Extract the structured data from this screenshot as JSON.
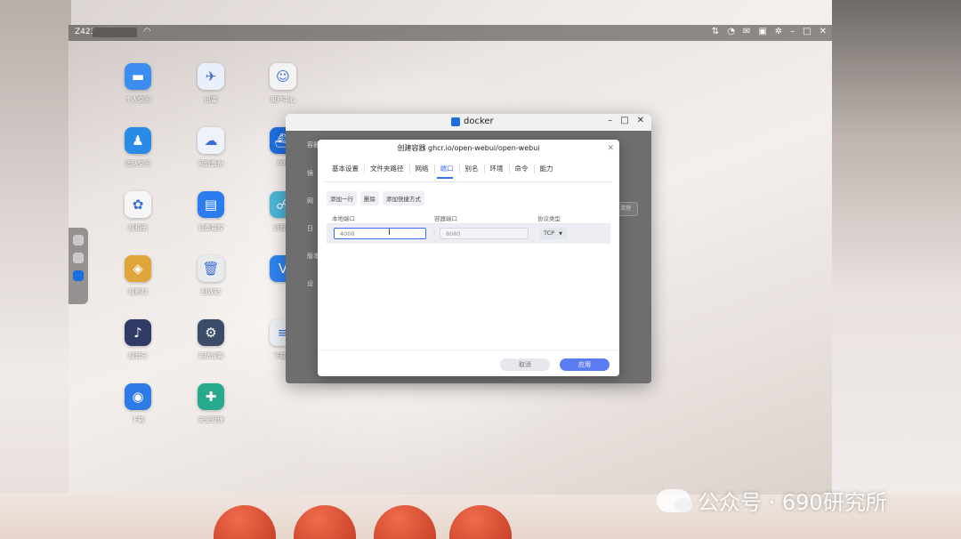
{
  "topbar": {
    "host": "Z423-",
    "icons": [
      "transfer-icon",
      "dashboard-icon",
      "mail-icon",
      "user-icon",
      "settings-icon",
      "minimize-icon",
      "restore-icon",
      "close-icon"
    ]
  },
  "desktop_apps": [
    {
      "label": "个人空间",
      "icon": "folder-icon",
      "color": "#3d8cf0",
      "glyph": "▬"
    },
    {
      "label": "迅雷",
      "icon": "thunder-icon",
      "color": "#eaf0fb",
      "glyph": "✈"
    },
    {
      "label": "用户中心",
      "icon": "user-center-icon",
      "color": "#f3f3f3",
      "glyph": "☺"
    },
    {
      "label": "团队空间",
      "icon": "team-folder-icon",
      "color": "#2a8be6",
      "glyph": "♟"
    },
    {
      "label": "网盘备份",
      "icon": "cloud-backup-icon",
      "color": "#eef3fb",
      "glyph": "☁"
    },
    {
      "label": "doc",
      "icon": "docker-icon",
      "color": "#1d6fe0",
      "glyph": "⛴"
    },
    {
      "label": "极相册",
      "icon": "photos-icon",
      "color": "#f6f6f6",
      "glyph": "✿"
    },
    {
      "label": "设备监控",
      "icon": "monitor-icon",
      "color": "#2b7cef",
      "glyph": "▤"
    },
    {
      "label": "远程访",
      "icon": "remote-icon",
      "color": "#4cb6d8",
      "glyph": "☍"
    },
    {
      "label": "极影视",
      "icon": "video-icon",
      "color": "#e0a63a",
      "glyph": "◈"
    },
    {
      "label": "回收站",
      "icon": "trash-icon",
      "color": "#e9eaec",
      "glyph": "🗑"
    },
    {
      "label": "",
      "icon": "v-app-icon",
      "color": "#2e85f3",
      "glyph": "V"
    },
    {
      "label": "极音乐",
      "icon": "music-icon",
      "color": "#2f3a66",
      "glyph": "♪"
    },
    {
      "label": "系统设置",
      "icon": "system-settings-icon",
      "color": "#3b4c69",
      "glyph": "⚙"
    },
    {
      "label": "下载管",
      "icon": "download-manager-icon",
      "color": "#eef2f6",
      "glyph": "≡"
    },
    {
      "label": "下载",
      "icon": "download-icon",
      "color": "#2f7be6",
      "glyph": "◉"
    },
    {
      "label": "安全管理",
      "icon": "security-icon",
      "color": "#27a98d",
      "glyph": "✚"
    }
  ],
  "docker_window": {
    "title": "docker",
    "side_fragments": [
      "容器",
      "镜",
      "网",
      "日",
      "版本",
      "设"
    ],
    "bg_button": "清理"
  },
  "modal": {
    "title": "创建容器 ghcr.io/open-webui/open-webui",
    "tabs": [
      {
        "label": "基本设置",
        "active": false
      },
      {
        "label": "文件夹路径",
        "active": false
      },
      {
        "label": "网络",
        "active": false
      },
      {
        "label": "端口",
        "active": true
      },
      {
        "label": "别名",
        "active": false
      },
      {
        "label": "环境",
        "active": false
      },
      {
        "label": "命令",
        "active": false
      },
      {
        "label": "能力",
        "active": false
      }
    ],
    "actions": [
      "添加一行",
      "删除",
      "添加快捷方式"
    ],
    "columns": [
      "本地端口",
      "容器端口",
      "协议类型"
    ],
    "row": {
      "local_port": "4000",
      "separator": ":",
      "container_port": "8080",
      "protocol": "TCP"
    },
    "cancel": "取消",
    "apply": "应用"
  },
  "watermark": "公众号 · 690研究所"
}
